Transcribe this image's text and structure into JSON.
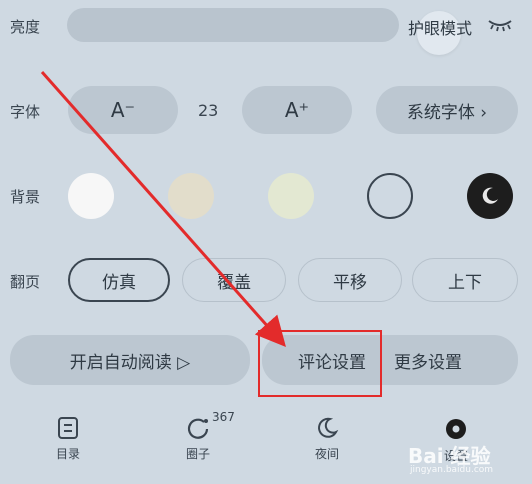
{
  "brightness": {
    "label": "亮度",
    "level": 0.86,
    "eye_mode_label": "护眼模式"
  },
  "font": {
    "label": "字体",
    "decrease_label": "A⁻",
    "size_value": "23",
    "increase_label": "A⁺",
    "system_font_label": "系统字体 ›"
  },
  "background": {
    "label": "背景",
    "swatches": [
      {
        "name": "white",
        "color": "#f7f7f7"
      },
      {
        "name": "beige",
        "color": "#e2ddcb"
      },
      {
        "name": "light-green",
        "color": "#e3e8d2"
      },
      {
        "name": "transparent-ring",
        "color": "#cfd9e2"
      },
      {
        "name": "dark",
        "color": "#1d1d1d"
      }
    ],
    "selected": "dark"
  },
  "page_turn": {
    "label": "翻页",
    "options": [
      "仿真",
      "覆盖",
      "平移",
      "上下"
    ],
    "selected": "仿真"
  },
  "actions": {
    "auto_read_label": "开启自动阅读 ▷",
    "comment_settings_label": "评论设置",
    "more_settings_label": "更多设置"
  },
  "bottom_nav": {
    "catalog_label": "目录",
    "circle_label": "圈子",
    "circle_badge": "367",
    "night_label": "夜间",
    "settings_label": "设置"
  },
  "watermark": {
    "text": "Bai 经验",
    "sub": "jingyan.baidu.com"
  },
  "colors": {
    "annotation_red": "#e32b2b",
    "panel_bg": "#cfd9e2",
    "pill_bg": "#bcc7d1"
  }
}
